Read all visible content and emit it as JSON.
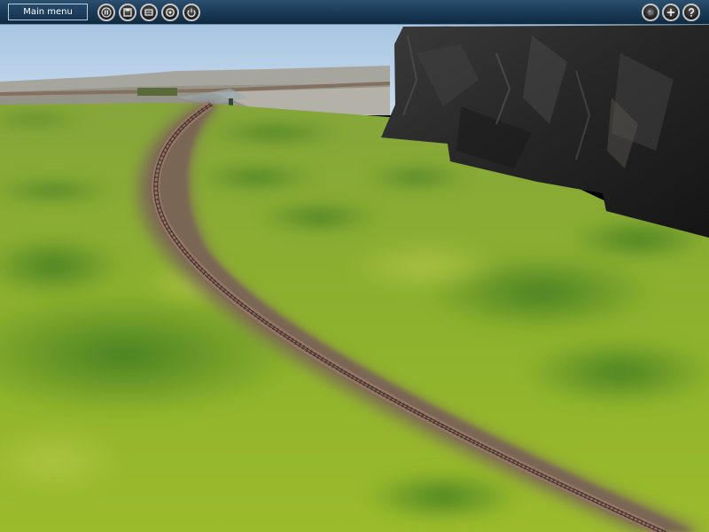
{
  "toolbar": {
    "main_menu_label": "Main menu",
    "left_buttons": [
      "pause-icon",
      "save-icon",
      "map-icon",
      "settings-icon",
      "power-icon"
    ],
    "right_buttons": [
      "orb-icon",
      "add-icon",
      "help-icon"
    ]
  },
  "scene": {
    "sky_color": "#a9c6e3",
    "grass_color": "#8cae2c",
    "track_color": "#7b6454",
    "rock_color": "#2a2a2a"
  }
}
